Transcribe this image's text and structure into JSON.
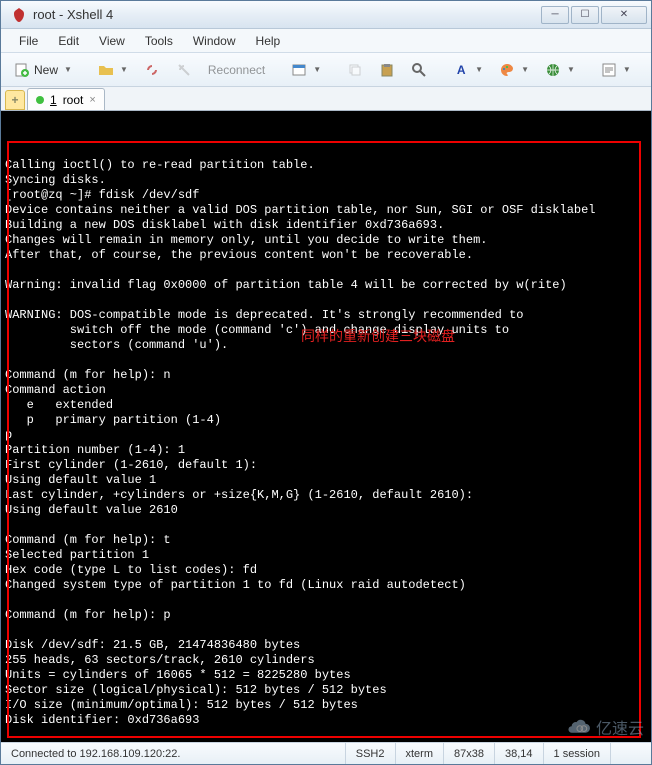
{
  "titlebar": {
    "title": "root - Xshell 4"
  },
  "menu": {
    "file": "File",
    "edit": "Edit",
    "view": "View",
    "tools": "Tools",
    "window": "Window",
    "help": "Help"
  },
  "toolbar": {
    "new": "New",
    "reconnect": "Reconnect"
  },
  "tabs": {
    "active_index": "1",
    "active_label": "root"
  },
  "terminal": {
    "lines": [
      "Calling ioctl() to re-read partition table.",
      "Syncing disks.",
      "[root@zq ~]# fdisk /dev/sdf",
      "Device contains neither a valid DOS partition table, nor Sun, SGI or OSF disklabel",
      "Building a new DOS disklabel with disk identifier 0xd736a693.",
      "Changes will remain in memory only, until you decide to write them.",
      "After that, of course, the previous content won't be recoverable.",
      "",
      "Warning: invalid flag 0x0000 of partition table 4 will be corrected by w(rite)",
      "",
      "WARNING: DOS-compatible mode is deprecated. It's strongly recommended to",
      "         switch off the mode (command 'c') and change display units to",
      "         sectors (command 'u').",
      "",
      "Command (m for help): n",
      "Command action",
      "   e   extended",
      "   p   primary partition (1-4)",
      "p",
      "Partition number (1-4): 1",
      "First cylinder (1-2610, default 1):",
      "Using default value 1",
      "Last cylinder, +cylinders or +size{K,M,G} (1-2610, default 2610):",
      "Using default value 2610",
      "",
      "Command (m for help): t",
      "Selected partition 1",
      "Hex code (type L to list codes): fd",
      "Changed system type of partition 1 to fd (Linux raid autodetect)",
      "",
      "Command (m for help): p",
      "",
      "Disk /dev/sdf: 21.5 GB, 21474836480 bytes",
      "255 heads, 63 sectors/track, 2610 cylinders",
      "Units = cylinders of 16065 * 512 = 8225280 bytes",
      "Sector size (logical/physical): 512 bytes / 512 bytes",
      "I/O size (minimum/optimal): 512 bytes / 512 bytes",
      "Disk identifier: 0xd736a693"
    ],
    "annotation": "同样的重新创建三块磁盘"
  },
  "status": {
    "connection": "Connected to 192.168.109.120:22.",
    "protocol": "SSH2",
    "term": "xterm",
    "size": "87x38",
    "pos": "38,14",
    "sessions": "1 session"
  },
  "watermark": "亿速云"
}
